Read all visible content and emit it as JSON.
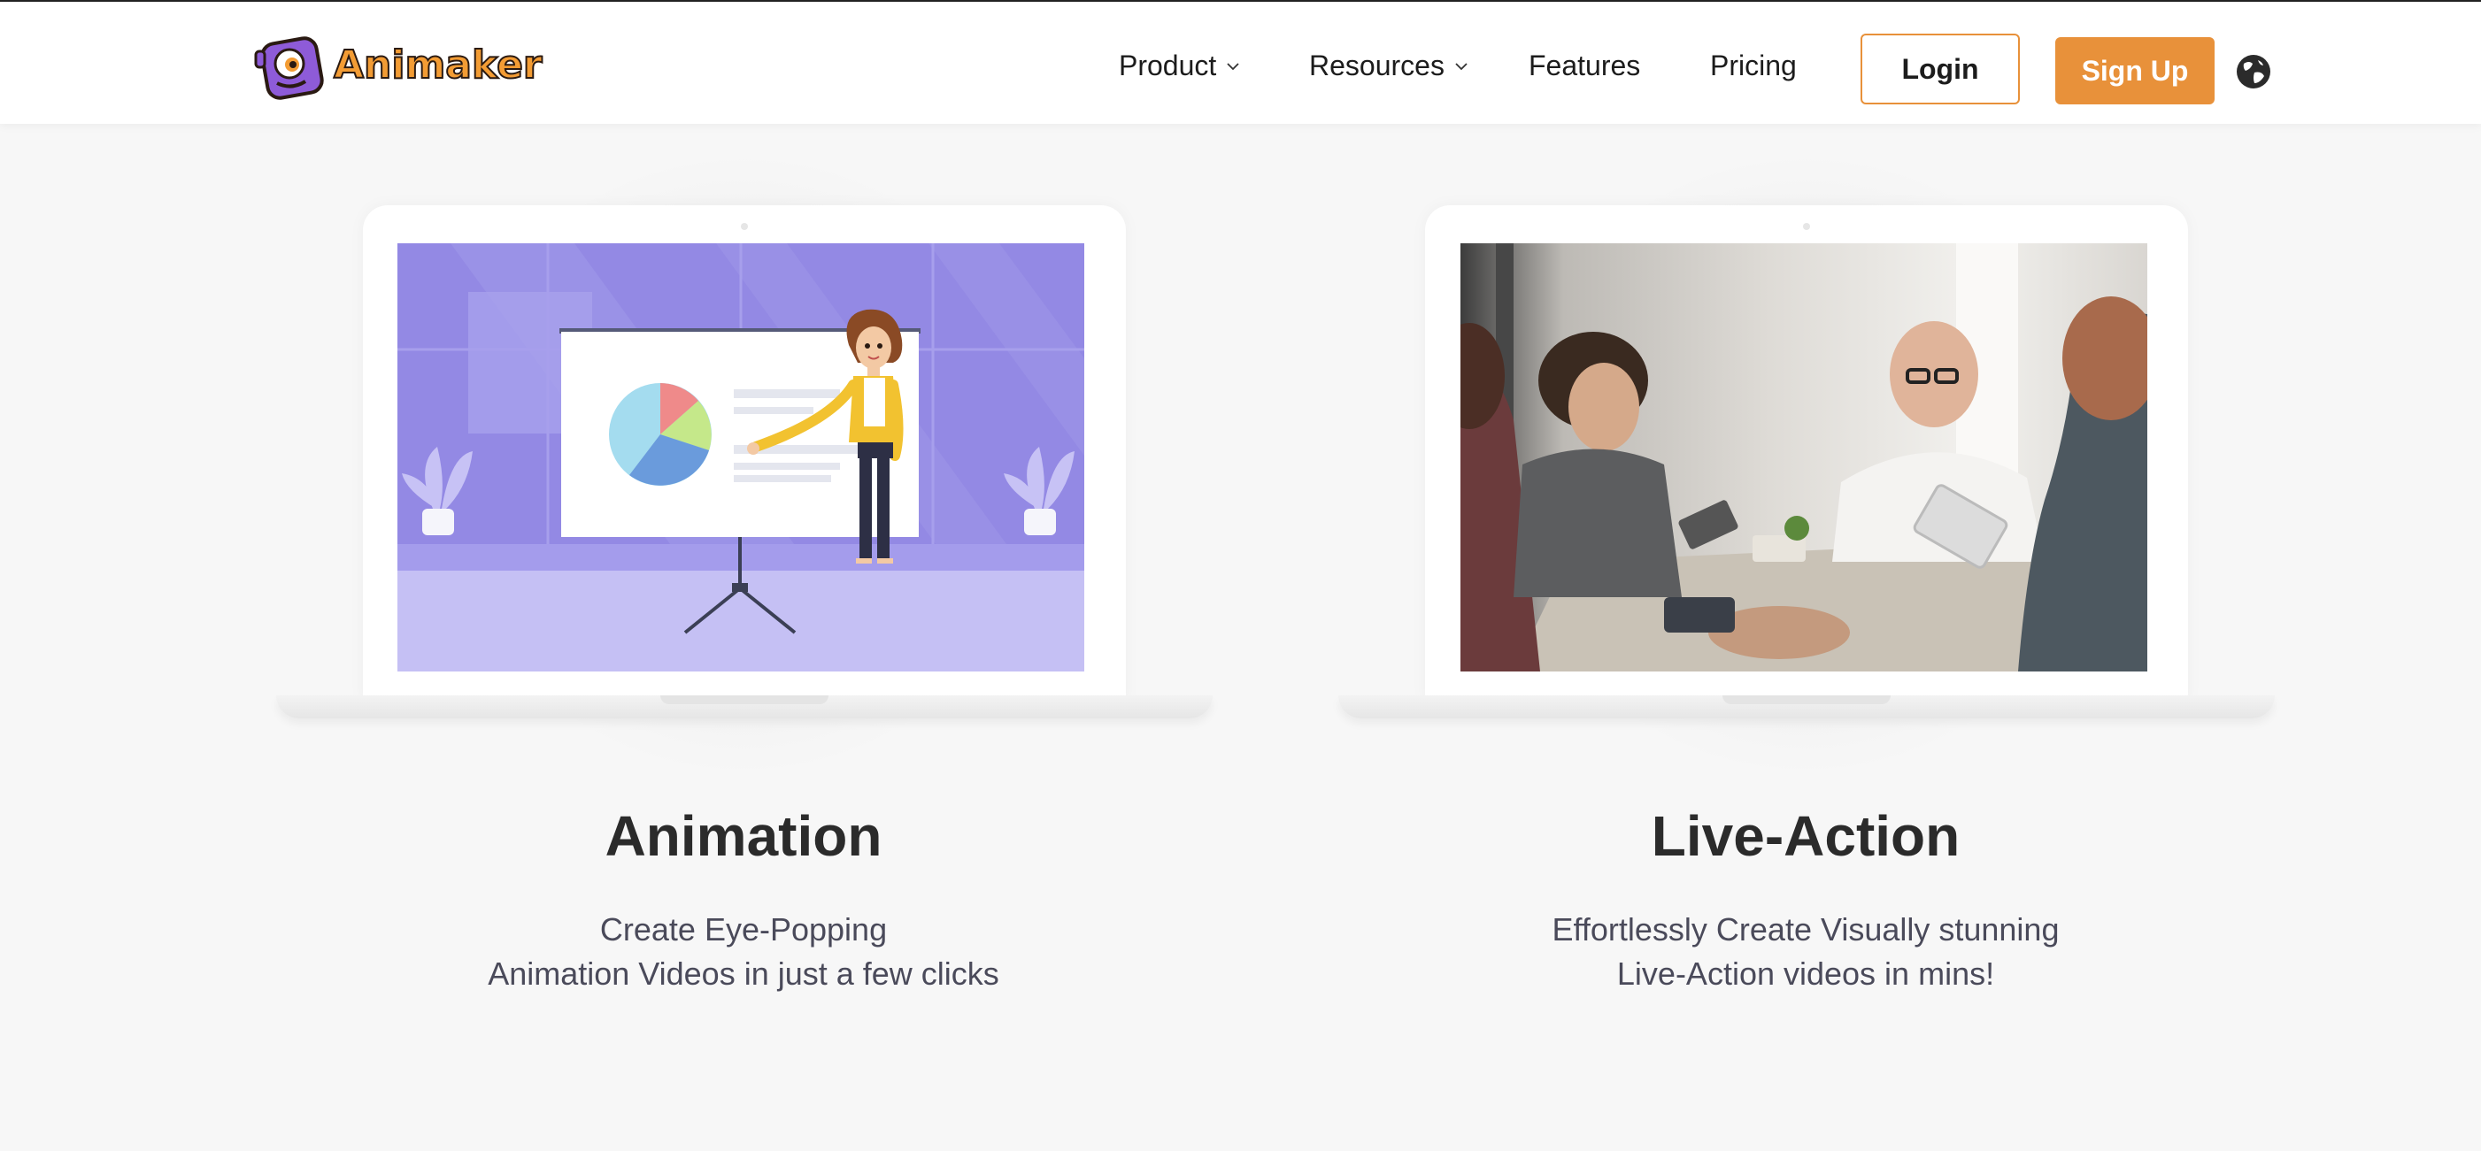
{
  "header": {
    "logo_text": "Animaker",
    "nav": [
      {
        "label": "Product",
        "has_dropdown": true
      },
      {
        "label": "Resources",
        "has_dropdown": true
      },
      {
        "label": "Features",
        "has_dropdown": false
      },
      {
        "label": "Pricing",
        "has_dropdown": false
      }
    ],
    "login_label": "Login",
    "signup_label": "Sign Up",
    "language_icon": "globe-icon"
  },
  "cards": [
    {
      "title": "Animation",
      "desc_line1": "Create Eye-Popping",
      "desc_line2": "Animation Videos in just a few clicks"
    },
    {
      "title": "Live-Action",
      "desc_line1": "Effortlessly Create Visually stunning",
      "desc_line2": "Live-Action videos in mins!"
    }
  ],
  "colors": {
    "accent": "#e8913a",
    "background": "#f7f7f7",
    "animation_scene": "#9389e4"
  }
}
